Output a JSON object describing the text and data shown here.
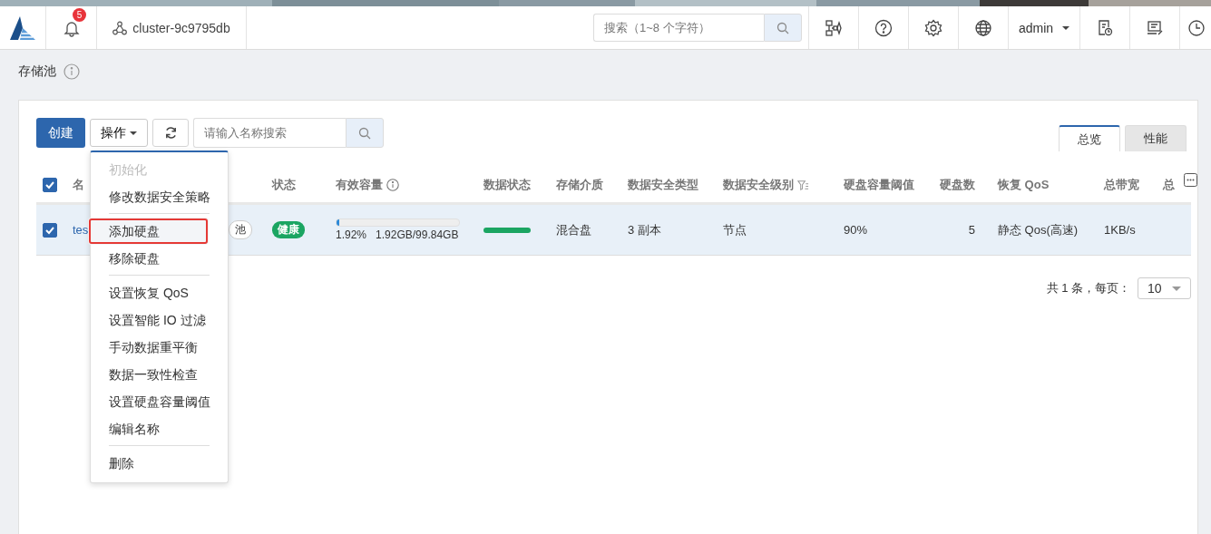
{
  "header": {
    "notifications": "5",
    "cluster": "cluster-9c9795db",
    "search": {
      "placeholder": "搜索（1~8 个字符）"
    },
    "user": "admin"
  },
  "page": {
    "title": "存储池"
  },
  "toolbar": {
    "create": "创建",
    "actions": "操作",
    "search": {
      "placeholder": "请输入名称搜索"
    }
  },
  "tabs": [
    {
      "label": "总览",
      "selected": true
    },
    {
      "label": "性能",
      "selected": false
    }
  ],
  "table": {
    "all_checked": true,
    "columns": [
      "名",
      "状态",
      "有效容量",
      "数据状态",
      "存储介质",
      "数据安全类型",
      "数据安全级别",
      "硬盘容量阈值",
      "硬盘数",
      "恢复 QoS",
      "总带宽",
      "总"
    ],
    "rows": [
      {
        "checked": true,
        "selected": true,
        "name": "tes",
        "tag": "池",
        "status": "健康",
        "capacity": {
          "level": 0.0192,
          "percent": "1.92%",
          "reading": "1.92GB/99.84GB"
        },
        "data_status": {
          "level": 1
        },
        "medium": "混合盘",
        "safety_type": "3 副本",
        "safety_level": "节点",
        "threshold": "90%",
        "disks": "5",
        "qos": "静态 Qos(高速)",
        "bandwidth": "1KB/s"
      }
    ]
  },
  "pagination": {
    "total": "共 1 条，每页：",
    "page_size": "10"
  },
  "menu": [
    {
      "kind": "item",
      "label": "初始化",
      "disabled": true,
      "highlighted": false
    },
    {
      "kind": "item",
      "label": "修改数据安全策略",
      "disabled": false,
      "highlighted": false
    },
    {
      "kind": "divider"
    },
    {
      "kind": "item",
      "label": "添加硬盘",
      "disabled": false,
      "highlighted": true
    },
    {
      "kind": "item",
      "label": "移除硬盘",
      "disabled": false,
      "highlighted": false
    },
    {
      "kind": "divider"
    },
    {
      "kind": "item",
      "label": "设置恢复 QoS",
      "disabled": false,
      "highlighted": false
    },
    {
      "kind": "item",
      "label": "设置智能 IO 过滤",
      "disabled": false,
      "highlighted": false
    },
    {
      "kind": "item",
      "label": "手动数据重平衡",
      "disabled": false,
      "highlighted": false
    },
    {
      "kind": "item",
      "label": "数据一致性检查",
      "disabled": false,
      "highlighted": false
    },
    {
      "kind": "item",
      "label": "设置硬盘容量阈值",
      "disabled": false,
      "highlighted": false
    },
    {
      "kind": "item",
      "label": "编辑名称",
      "disabled": false,
      "highlighted": false
    },
    {
      "kind": "divider"
    },
    {
      "kind": "item",
      "label": "删除",
      "disabled": false,
      "highlighted": false
    }
  ]
}
